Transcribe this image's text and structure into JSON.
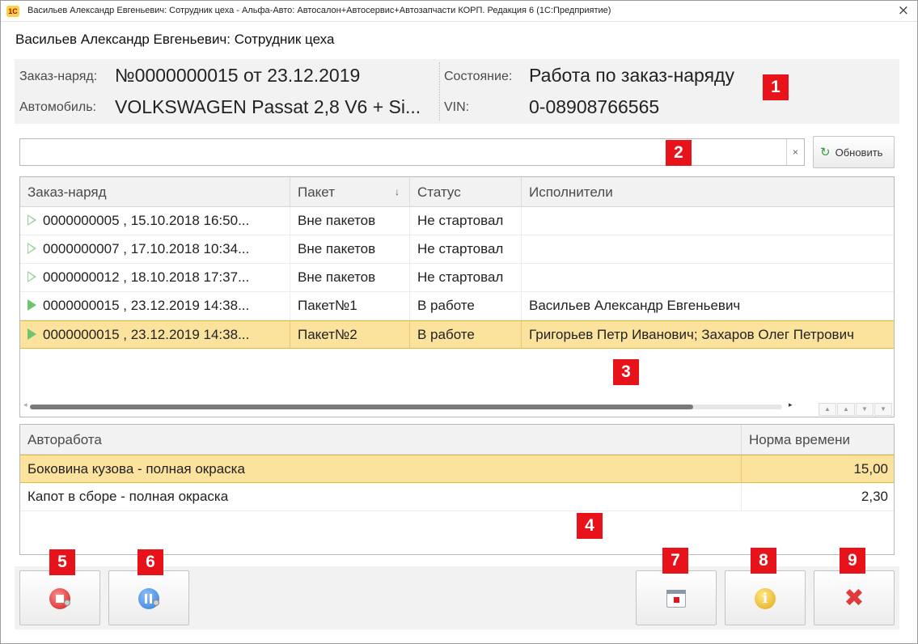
{
  "window": {
    "title": "Васильев Александр Евгеньевич: Сотрудник цеха - Альфа-Авто: Автосалон+Автосервис+Автозапчасти КОРП. Редакция 6  (1С:Предприятие)",
    "logo_text": "1С",
    "close_glyph": "×"
  },
  "form": {
    "title": "Васильев Александр Евгеньевич: Сотрудник цеха"
  },
  "header": {
    "order_label": "Заказ-наряд:",
    "order_value": "№0000000015   от 23.12.2019",
    "car_label": "Автомобиль:",
    "car_value": "VOLKSWAGEN Passat 2,8 V6 + Si...",
    "state_label": "Состояние:",
    "state_value": "Работа по заказ-наряду",
    "vin_label": "VIN:",
    "vin_value": "0-08908766565"
  },
  "search": {
    "value": "",
    "placeholder": "",
    "clear_glyph": "×",
    "refresh_label": "Обновить",
    "refresh_icon": "refresh-icon"
  },
  "orders_table": {
    "columns": [
      "Заказ-наряд",
      "Пакет",
      "Статус",
      "Исполнители"
    ],
    "sort_glyph": "↓",
    "rows": [
      {
        "order": "0000000005 , 15.10.2018 16:50...",
        "packet": "Вне пакетов",
        "status": "Не стартовал",
        "performers": "",
        "icon": "play-outline-icon"
      },
      {
        "order": "0000000007 , 17.10.2018 10:34...",
        "packet": "Вне пакетов",
        "status": "Не стартовал",
        "performers": "",
        "icon": "play-outline-icon"
      },
      {
        "order": "0000000012 , 18.10.2018 17:37...",
        "packet": "Вне пакетов",
        "status": "Не стартовал",
        "performers": "",
        "icon": "play-outline-icon"
      },
      {
        "order": "0000000015 , 23.12.2019 14:38...",
        "packet": "Пакет№1",
        "status": "В работе",
        "performers": "Васильев Александр Евгеньевич",
        "icon": "play-icon"
      },
      {
        "order": "0000000015 , 23.12.2019 14:38...",
        "packet": "Пакет№2",
        "status": "В работе",
        "performers": "Григорьев Петр Иванович; Захаров Олег Петрович",
        "icon": "play-icon",
        "selected": true
      }
    ],
    "nav": [
      "▲",
      "▲",
      "▼",
      "▼"
    ]
  },
  "works_table": {
    "columns": [
      "Авторабота",
      "Норма времени"
    ],
    "rows": [
      {
        "work": "Боковина кузова - полная окраска",
        "norm": "15,00",
        "selected": true
      },
      {
        "work": "Капот в сборе - полная окраска",
        "norm": "2,30"
      }
    ]
  },
  "toolbar": {
    "buttons": [
      {
        "name": "stop-button",
        "icon": "stop-icon"
      },
      {
        "name": "pause-button",
        "icon": "pause-icon"
      },
      {
        "name": "calendar-button",
        "icon": "calendar-icon"
      },
      {
        "name": "info-button",
        "icon": "info-icon",
        "glyph": "i"
      },
      {
        "name": "close-button",
        "icon": "close-icon",
        "glyph": "✖"
      }
    ]
  },
  "annotations": [
    "1",
    "2",
    "3",
    "4",
    "5",
    "6",
    "7",
    "8",
    "9"
  ],
  "colors": {
    "selection": "#fbe39e",
    "badge": "#e8121b",
    "panel": "#f2f2f2"
  }
}
